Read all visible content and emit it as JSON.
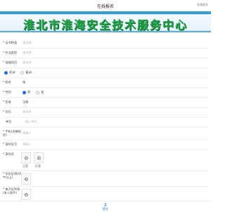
{
  "header": {
    "title": "在线报名",
    "right_text": "在线报名"
  },
  "banner": {
    "title": "淮北市淮海安全技术服务中心"
  },
  "fields": [
    {
      "label": "* 证书种类",
      "placeholder": "请选择",
      "value": ""
    },
    {
      "label": "* 作业类别",
      "placeholder": "请选择",
      "value": ""
    },
    {
      "label": "* 准操项目",
      "placeholder": "请选择",
      "value": ""
    }
  ],
  "exam_type": {
    "opt1": "初训",
    "opt2": "复训",
    "selected": "初训"
  },
  "rows": {
    "name": {
      "label": "* 姓名",
      "value": "张"
    },
    "gender": {
      "label": "* 性别",
      "male": "男",
      "female": "女",
      "selected": "男"
    },
    "nation": {
      "label": "* 民族",
      "value": "汉族"
    },
    "edu": {
      "label": "* 学历",
      "placeholder": "请选择"
    },
    "unit": {
      "label": "单位",
      "placeholder": "输入单位"
    },
    "phone": {
      "label": "* 手机(须做短信)",
      "placeholder": "请输入"
    },
    "id": {
      "label": "* 身份证号",
      "placeholder": "请输入"
    },
    "idphoto": {
      "label": "* 身份证",
      "front": "正面",
      "back": "反面"
    },
    "edu_cert": {
      "label": "* 学历证明(初中以上)"
    },
    "photo": {
      "label": "* 电子证件照(本人照片)"
    }
  },
  "bottom": {
    "label": "提交"
  },
  "colors": {
    "accent": "#1e6fe0",
    "banner_text": "#23a34b",
    "banner_bg": "#2a8fbd"
  }
}
